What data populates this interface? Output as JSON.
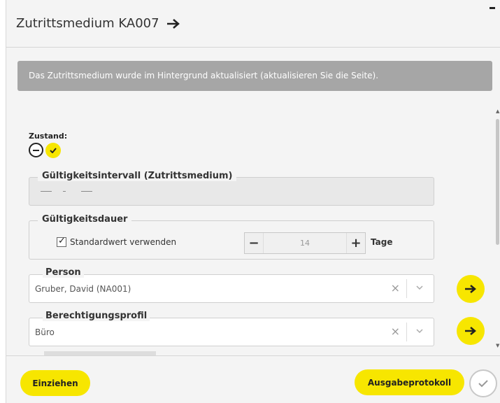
{
  "header": {
    "title": "Zutrittsmedium KA007"
  },
  "notice": {
    "text": "Das Zutrittsmedium wurde im Hintergrund aktualisiert (aktualisieren Sie die Seite)."
  },
  "state": {
    "label": "Zustand:"
  },
  "validity_interval": {
    "legend": "Gültigkeitsintervall (Zutrittsmedium)",
    "separator": "-"
  },
  "validity_duration": {
    "legend": "Gültigkeitsdauer",
    "use_default_label": "Standardwert verwenden",
    "use_default_checked": true,
    "value": "14",
    "unit": "Tage"
  },
  "person": {
    "label": "Person",
    "value": "Gruber, David (NA001)"
  },
  "profile": {
    "label": "Berechtigungsprofil",
    "value": "Büro"
  },
  "footer": {
    "withdraw_label": "Einziehen",
    "protocol_label": "Ausgabeprotokoll"
  },
  "colors": {
    "accent": "#f7e600",
    "notice_bg": "#a6a6a6",
    "panel_bg": "#f4f4f4"
  }
}
